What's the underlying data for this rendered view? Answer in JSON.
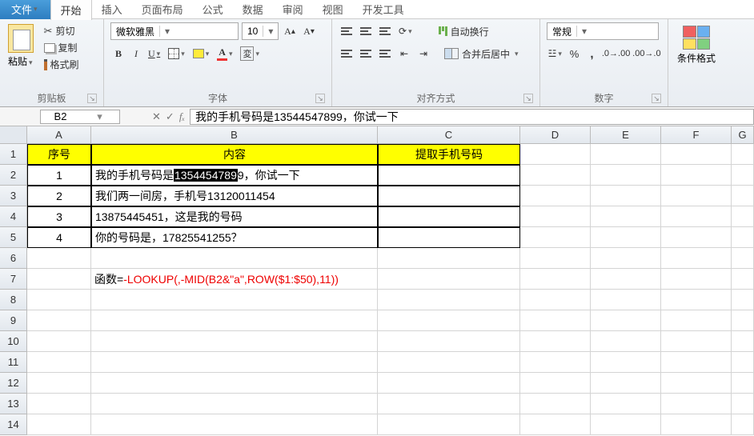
{
  "tabs": {
    "file": "文件",
    "home": "开始",
    "insert": "插入",
    "layout": "页面布局",
    "formulas": "公式",
    "data": "数据",
    "review": "审阅",
    "view": "视图",
    "dev": "开发工具"
  },
  "clipboard": {
    "paste": "粘贴",
    "cut": "剪切",
    "copy": "复制",
    "painter": "格式刷",
    "group": "剪贴板"
  },
  "font": {
    "name": "微软雅黑",
    "size": "10",
    "group": "字体"
  },
  "align": {
    "wrap": "自动换行",
    "merge": "合并后居中",
    "group": "对齐方式"
  },
  "number": {
    "format": "常规",
    "group": "数字"
  },
  "cf": {
    "label": "条件格式"
  },
  "ref": {
    "cell": "B2",
    "formula": "我的手机号码是13544547899，你试一下"
  },
  "cols": [
    "A",
    "B",
    "C",
    "D",
    "E",
    "F",
    "G"
  ],
  "headers": {
    "a": "序号",
    "b": "内容",
    "c": "提取手机号码"
  },
  "rows": [
    {
      "n": "1",
      "pre": "我的手机号码是",
      "hl": "1354454789",
      "post": "9，你试一下"
    },
    {
      "n": "2",
      "txt": "我们两一间房，手机号13120011454"
    },
    {
      "n": "3",
      "txt": "13875445451，这是我的号码"
    },
    {
      "n": "4",
      "txt": "你的号码是，17825541255？"
    }
  ],
  "formula_hint_label": "函数=",
  "formula_hint": "-LOOKUP(,-MID(B2&\"a\",ROW($1:$50),11))"
}
